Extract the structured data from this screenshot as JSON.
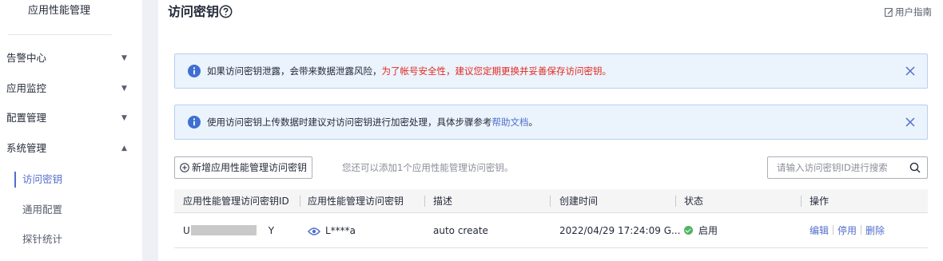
{
  "sidebar": {
    "title": "应用性能管理",
    "items": [
      {
        "label": "告警中心"
      },
      {
        "label": "应用监控"
      },
      {
        "label": "配置管理"
      },
      {
        "label": "系统管理"
      }
    ],
    "subitems": [
      {
        "label": "访问密钥"
      },
      {
        "label": "通用配置"
      },
      {
        "label": "探针统计"
      }
    ]
  },
  "header": {
    "title": "访问密钥",
    "guide_label": "用户指南"
  },
  "alerts": [
    {
      "text": "如果访问密钥泄露，会带来数据泄露风险，",
      "warning": "为了帐号安全性，建议您定期更换并妥善保存访问密钥。"
    },
    {
      "text": "使用访问密钥上传数据时建议对访问密钥进行加密处理，具体步骤参考",
      "link": "帮助文档",
      "suffix": "。"
    }
  ],
  "toolbar": {
    "add_label": "新增应用性能管理访问密钥",
    "hint": "您还可以添加1个应用性能管理访问密钥。",
    "search_placeholder": "请输入访问密钥ID进行搜索"
  },
  "table": {
    "columns": [
      "应用性能管理访问密钥ID",
      "应用性能管理访问密钥",
      "描述",
      "创建时间",
      "状态",
      "操作"
    ],
    "rows": [
      {
        "id_prefix": "U",
        "id_suffix": "Y",
        "key": "L****a",
        "description": "auto create",
        "created": "2022/04/29 17:24:09 G...",
        "status": "启用",
        "actions": [
          "编辑",
          "停用",
          "删除"
        ]
      }
    ]
  },
  "colors": {
    "accent": "#526ecc",
    "warning_text": "#e3281d",
    "status_ok": "#50b464",
    "alert_bg": "#ebf3fd",
    "info_icon": "#3f6fd1"
  }
}
